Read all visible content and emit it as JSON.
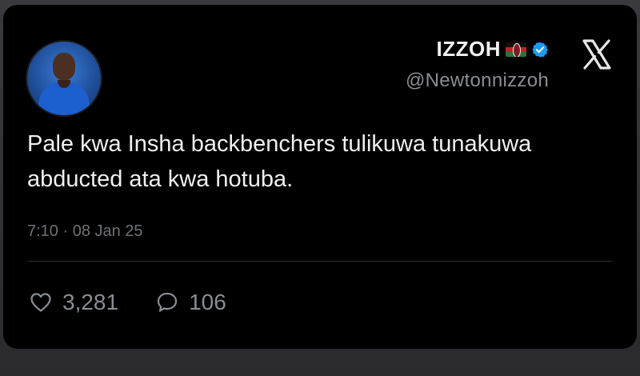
{
  "tweet": {
    "author": {
      "display_name": "IZZOH",
      "flag": "Kenya flag emoji",
      "verified_icon": "verified-badge-icon",
      "username": "@Newtonnizzoh"
    },
    "brand_icon": "x-logo-icon",
    "text": "Pale kwa Insha backbenchers tulikuwa tunakuwa abducted ata kwa hotuba.",
    "timestamp": "7:10 · 08 Jan 25",
    "actions": {
      "likes": {
        "icon": "heart-icon",
        "count": "3,281"
      },
      "replies": {
        "icon": "reply-bubble-icon",
        "count": "106"
      }
    }
  },
  "colors": {
    "background": "#000000",
    "text": "#f0f0f0",
    "muted": "#8a8d91",
    "verified": "#1d9bf0"
  }
}
